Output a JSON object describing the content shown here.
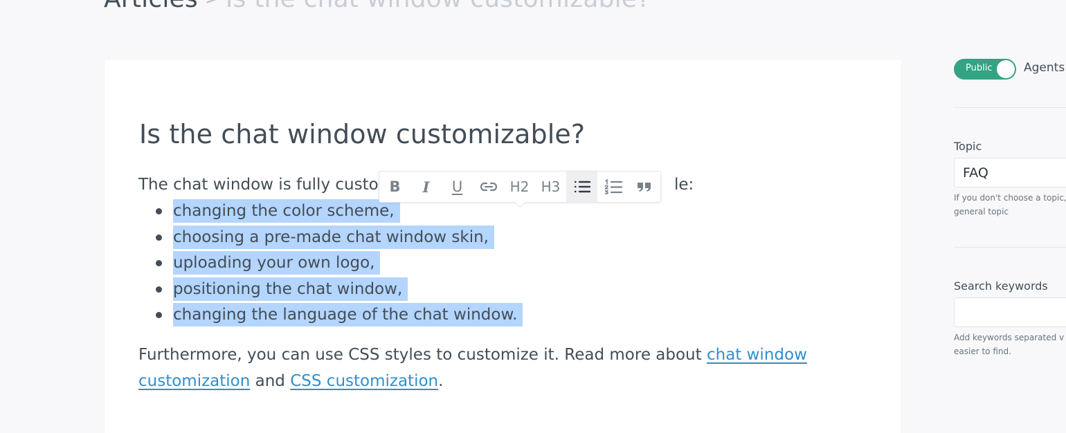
{
  "breadcrumb": {
    "root": "Articles",
    "separator": ">",
    "current": "Is the chat window customizable?"
  },
  "article": {
    "title": "Is the chat window customizable?",
    "intro_start": "The chat window is fully custor",
    "intro_end": "le:",
    "bullets": [
      "changing the color scheme,",
      "choosing a pre-made chat window skin,",
      "uploading your own logo,",
      "positioning the chat window,",
      "changing the language of the chat window."
    ],
    "para2_text": "Furthermore, you can use CSS styles to customize it. Read more about ",
    "link1": "chat window customization",
    "and_text": " and ",
    "link2": "CSS customization",
    "period": "."
  },
  "toolbar": {
    "bold": "B",
    "italic": "I",
    "underline": "U",
    "h2": "H2",
    "h3": "H3",
    "active_item": "bullet-list"
  },
  "sidebar": {
    "visibility_toggle": {
      "label": "Public",
      "on": true
    },
    "agents_label": "Agents",
    "topic": {
      "label": "Topic",
      "value": "FAQ",
      "hint_line1": "If you don't choose a topic,",
      "hint_line2": "general topic"
    },
    "keywords": {
      "label": "Search keywords",
      "value": "",
      "hint_line1": "Add keywords separated v",
      "hint_line2": "easier to find."
    }
  },
  "colors": {
    "accent_green": "#33a383",
    "link_blue": "#2e8fcf",
    "selection": "#b4d5fe",
    "text": "#424d57"
  }
}
